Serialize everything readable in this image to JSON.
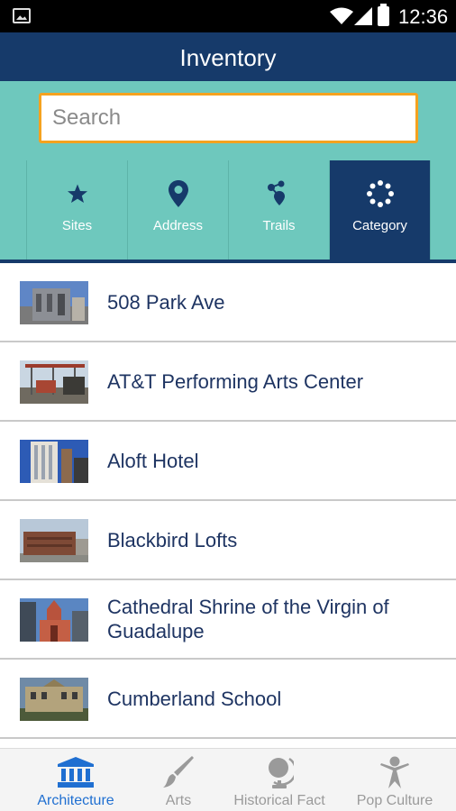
{
  "status_bar": {
    "time": "12:36"
  },
  "app_bar": {
    "title": "Inventory"
  },
  "search": {
    "placeholder": "Search",
    "value": ""
  },
  "filters": [
    {
      "label": "Sites",
      "icon": "star-icon",
      "active": false
    },
    {
      "label": "Address",
      "icon": "map-pin-icon",
      "active": false
    },
    {
      "label": "Trails",
      "icon": "trails-icon",
      "active": false
    },
    {
      "label": "Category",
      "icon": "category-dots-icon",
      "active": true
    }
  ],
  "list": [
    {
      "label": "508 Park Ave",
      "thumb": "building-modern-photo"
    },
    {
      "label": "AT&T Performing Arts Center",
      "thumb": "arts-center-photo"
    },
    {
      "label": "Aloft Hotel",
      "thumb": "hotel-tower-photo"
    },
    {
      "label": "Blackbird Lofts",
      "thumb": "brick-lofts-photo"
    },
    {
      "label": "Cathedral Shrine of the Virgin of Guadalupe",
      "thumb": "cathedral-photo"
    },
    {
      "label": "Cumberland School",
      "thumb": "school-photo"
    }
  ],
  "bottom_nav": [
    {
      "label": "Architecture",
      "icon": "columns-building-icon",
      "active": true
    },
    {
      "label": "Arts",
      "icon": "paintbrush-icon",
      "active": false
    },
    {
      "label": "Historical Fact",
      "icon": "globe-icon",
      "active": false
    },
    {
      "label": "Pop Culture",
      "icon": "person-star-icon",
      "active": false
    }
  ],
  "colors": {
    "app_bar": "#163a6a",
    "teal": "#6ec8bd",
    "search_border": "#f5a21f",
    "list_text": "#1e3462",
    "nav_active": "#1f6fd1",
    "nav_inactive": "#9a9a9a"
  }
}
